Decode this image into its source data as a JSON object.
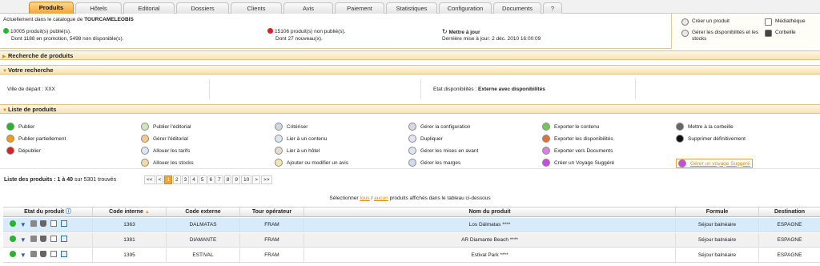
{
  "tabs": [
    {
      "label": "Produits",
      "active": true
    },
    {
      "label": "Hôtels"
    },
    {
      "label": "Editorial"
    },
    {
      "label": "Dossiers"
    },
    {
      "label": "Clients"
    },
    {
      "label": "Avis"
    },
    {
      "label": "Paiement"
    },
    {
      "label": "Statistiques"
    },
    {
      "label": "Configuration"
    },
    {
      "label": "Documents"
    },
    {
      "label": "?"
    }
  ],
  "header": {
    "catalogue_prefix": "Actuellement dans le catalogue de",
    "catalogue_name": "TOURCAMELEOBIS",
    "published": "10005 produit(s) publié(s).",
    "published_detail": "Dont 1188 en promotion, 5498 non disponible(s).",
    "unpublished": "15106 produit(s) non publié(s).",
    "unpublished_detail": "Dont 27 nouveau(x).",
    "update_label": "Mettre à jour",
    "last_update": "Dernière mise à jour: 2 déc. 2010 16:00:09"
  },
  "quick_actions": {
    "create": "Créer un produit",
    "manage_stock": "Gérer les disponibilités et les stocks",
    "media": "Médiathèque",
    "trash": "Corbeille"
  },
  "sections": {
    "search": "Recherche de produits",
    "your_search": "Votre recherche",
    "list": "Liste de produits"
  },
  "search_summary": {
    "departure_label": "Ville de départ :",
    "departure_value": "XXX",
    "availability_label": "Etat disponibilités :",
    "availability_value": "Externe avec disponibilités"
  },
  "actions": {
    "col1": [
      "Publier",
      "Publier partiellement",
      "Dépublier"
    ],
    "col2": [
      "Publier l'éditorial",
      "Gérer l'éditorial",
      "Allouer les tarifs",
      "Allouer les stocks"
    ],
    "col3": [
      "Critériser",
      "Lier à un contenu",
      "Lier à un hôtel",
      "Ajouter ou modifier un avis"
    ],
    "col4": [
      "Gérer la configuration",
      "Dupliquer",
      "Gérer les mises en avant",
      "Gérer les marges"
    ],
    "col5": [
      "Exporter le contenu",
      "Exporter les disponibilités",
      "Exporter vers Documents",
      "Créer un Voyage Suggéré"
    ],
    "col6": [
      "Mettre à la corbeille",
      "Supprimer définitivement",
      "Gérer un voyage Suggéré"
    ]
  },
  "list": {
    "title_prefix": "Liste des produits :",
    "range": "1 à 40",
    "total": "sur 5301 trouvés",
    "pages": [
      "<<",
      "<",
      "1",
      "2",
      "3",
      "4",
      "5",
      "6",
      "7",
      "8",
      "9",
      "10",
      ">",
      ">>"
    ],
    "current_page": "1"
  },
  "select_line": {
    "prefix": "Sélectionner",
    "all": "tous",
    "sep": "/",
    "none": "aucun",
    "suffix": "produits affichés dans le tableau ci-dessous"
  },
  "table": {
    "headers": [
      "Etat du produit",
      "Code interne",
      "Code externe",
      "Tour opérateur",
      "Nom du produit",
      "Formule",
      "Destination"
    ],
    "rows": [
      {
        "code_interne": "1363",
        "code_externe": "DALMATAS",
        "tour": "FRAM",
        "nom": "Los Dálmatas ****",
        "formule": "Séjour balnéaire",
        "destination": "ESPAGNE"
      },
      {
        "code_interne": "1381",
        "code_externe": "DIAMANTE",
        "tour": "FRAM",
        "nom": "AR Diamante Beach ****",
        "formule": "Séjour balnéaire",
        "destination": "ESPAGNE"
      },
      {
        "code_interne": "1395",
        "code_externe": "ESTIVAL",
        "tour": "FRAM",
        "nom": "Estival Park ****",
        "formule": "Séjour balnéaire",
        "destination": "ESPAGNE"
      }
    ]
  },
  "colors": {
    "accent": "#f4a32e",
    "link": "#d88900",
    "selected_row": "#d7ebfb",
    "green": "#27b52b",
    "red": "#e02020"
  }
}
